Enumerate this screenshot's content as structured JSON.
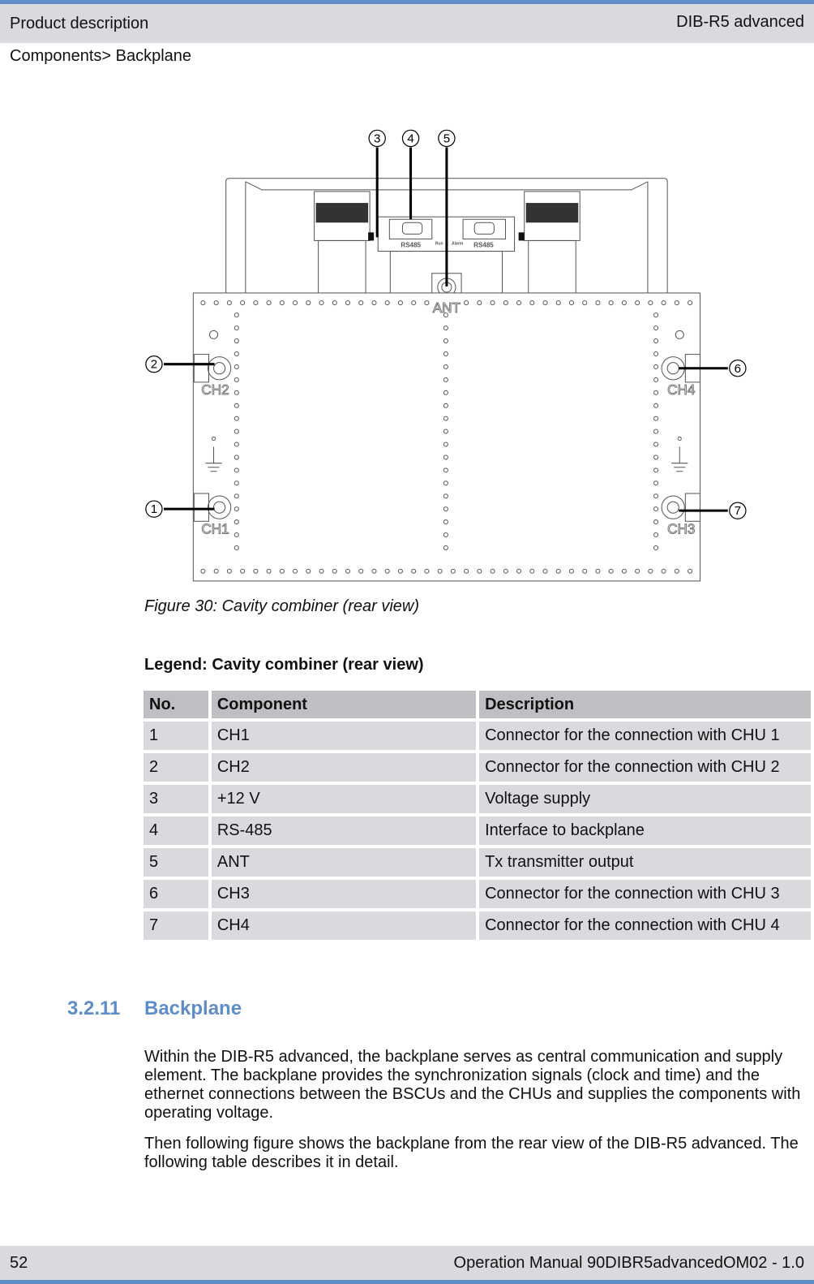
{
  "header": {
    "section": "Product description",
    "product": "DIB-R5 advanced"
  },
  "breadcrumb": "Components> Backplane",
  "figure": {
    "callouts": [
      "1",
      "2",
      "3",
      "4",
      "5",
      "6",
      "7"
    ],
    "labels": {
      "ch1": "CH1",
      "ch2": "CH2",
      "ch3": "CH3",
      "ch4": "CH4",
      "ant": "ANT",
      "rs485_left": "RS485",
      "rs485_right": "RS485",
      "run": "Run",
      "alarm": "Alarm"
    },
    "caption": "Figure 30: Cavity combiner (rear view)"
  },
  "legend": {
    "title": "Legend: Cavity combiner (rear view)",
    "columns": [
      "No.",
      "Component",
      "Description"
    ],
    "rows": [
      [
        "1",
        "CH1",
        "Connector for the connection with CHU 1"
      ],
      [
        "2",
        "CH2",
        "Connector for the connection with CHU 2"
      ],
      [
        "3",
        "+12 V",
        "Voltage supply"
      ],
      [
        "4",
        "RS-485",
        "Interface to backplane"
      ],
      [
        "5",
        "ANT",
        "Tx transmitter output"
      ],
      [
        "6",
        "CH3",
        "Connector for the connection with CHU 3"
      ],
      [
        "7",
        "CH4",
        "Connector for the connection with CHU 4"
      ]
    ]
  },
  "section": {
    "number": "3.2.11",
    "title": "Backplane",
    "paragraphs": [
      "Within the DIB-R5 advanced, the backplane serves as central communication and supply element. The backplane provides the synchronization signals (clock and time) and the ethernet connections between the BSCUs and the CHUs and supplies the components with operating voltage.",
      "Then following figure shows the backplane from the rear view of the DIB-R5 advanced. The following table describes it in detail."
    ]
  },
  "footer": {
    "page": "52",
    "doc": "Operation Manual 90DIBR5advancedOM02 - 1.0"
  }
}
